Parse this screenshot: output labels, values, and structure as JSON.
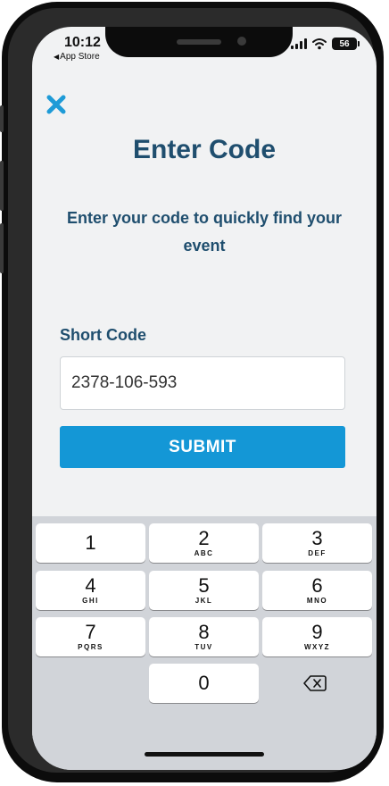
{
  "status_bar": {
    "time": "10:12",
    "back_app": "App Store",
    "battery": "56"
  },
  "header": {
    "title": "Enter Code",
    "subtitle": "Enter your code to quickly find your event"
  },
  "form": {
    "field_label": "Short Code",
    "code_value": "2378-106-593",
    "submit_label": "SUBMIT"
  },
  "keypad": {
    "keys": [
      {
        "digit": "1",
        "letters": ""
      },
      {
        "digit": "2",
        "letters": "ABC"
      },
      {
        "digit": "3",
        "letters": "DEF"
      },
      {
        "digit": "4",
        "letters": "GHI"
      },
      {
        "digit": "5",
        "letters": "JKL"
      },
      {
        "digit": "6",
        "letters": "MNO"
      },
      {
        "digit": "7",
        "letters": "PQRS"
      },
      {
        "digit": "8",
        "letters": "TUV"
      },
      {
        "digit": "9",
        "letters": "WXYZ"
      },
      {
        "digit": "0",
        "letters": ""
      }
    ]
  },
  "colors": {
    "accent": "#1497d6",
    "heading": "#1f4e6e",
    "close_icon": "#1e9bd7",
    "keyboard_bg": "#d1d4d9"
  }
}
